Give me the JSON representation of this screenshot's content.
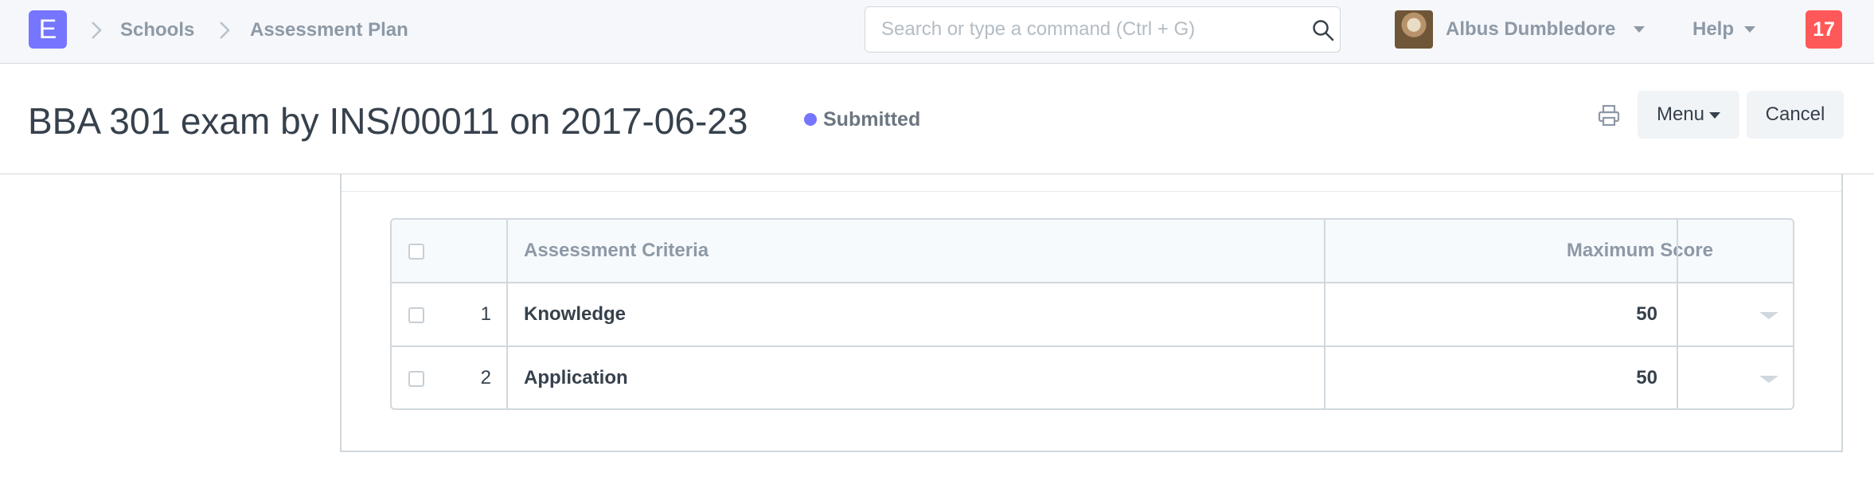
{
  "navbar": {
    "logo_letter": "E",
    "breadcrumbs": [
      "Schools",
      "Assessment Plan"
    ],
    "search": {
      "placeholder": "Search or type a command (Ctrl + G)",
      "value": ""
    },
    "user_name": "Albus Dumbledore",
    "help_label": "Help",
    "notification_count": "17"
  },
  "page": {
    "title": "BBA 301 exam by INS/00011 on 2017-06-23",
    "status": "Submitted",
    "status_color": "#7575ff",
    "menu_label": "Menu",
    "cancel_label": "Cancel"
  },
  "grid": {
    "columns": [
      "",
      "Assessment Criteria",
      "Maximum Score",
      ""
    ],
    "rows": [
      {
        "idx": "1",
        "criteria": "Knowledge",
        "max_score": "50"
      },
      {
        "idx": "2",
        "criteria": "Application",
        "max_score": "50"
      }
    ]
  },
  "icons": {
    "logo": "erpnext-logo-icon",
    "search": "search-icon",
    "print": "printer-icon",
    "row_menu": "chevron-down-icon"
  }
}
